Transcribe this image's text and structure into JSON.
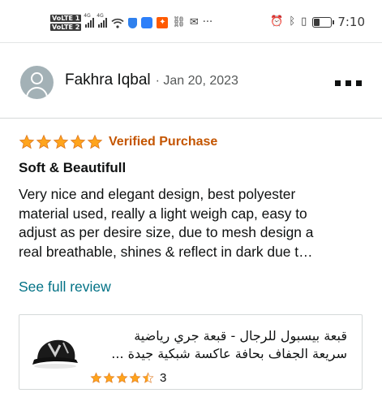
{
  "status_bar": {
    "sim1_badge": "VoLTE 1",
    "sim2_badge": "VoLTE 2",
    "signal1_type": "4G",
    "signal2_type": "4G",
    "time": "7:10",
    "icons": [
      "volte-icon",
      "signal-icon",
      "wifi-icon",
      "shield-icon",
      "cloud-icon",
      "aliexpress-icon",
      "link-icon",
      "mail-icon",
      "more-notifications-icon",
      "alarm-icon",
      "bluetooth-icon",
      "vibrate-icon",
      "battery-icon"
    ]
  },
  "review": {
    "reviewer_name": "Fakhra Iqbal",
    "date": "· Jan 20, 2023",
    "rating": 5,
    "max_rating": 5,
    "badge": "Verified Purchase",
    "title": "Soft & Beautifull",
    "body_lines": [
      "Very nice and elegant design, best polyester",
      "material used, really a light weigh cap, easy to",
      "adjust as per desire size, due to mesh design a",
      "real breathable, shines & reflect in dark due t…"
    ],
    "see_full_label": "See full review"
  },
  "product": {
    "title_lines": [
      "قبعة بيسبول للرجال - قبعة جري رياضية",
      "سريعة الجفاف بحافة عاكسة شبكية جيدة ..."
    ],
    "rating": 4.5,
    "rating_count": "3"
  },
  "colors": {
    "star": "#ffa41c",
    "verified": "#c45500",
    "link": "#007185",
    "text": "#0f1111",
    "muted": "#565959"
  }
}
